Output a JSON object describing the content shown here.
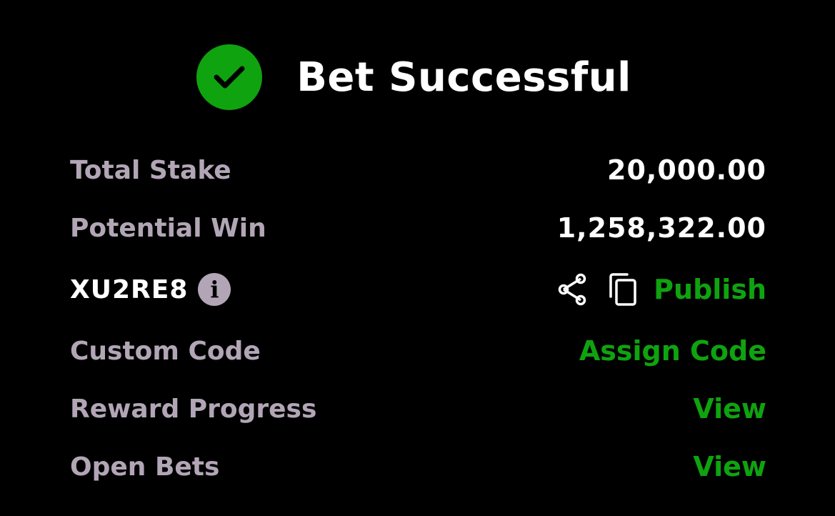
{
  "header": {
    "title": "Bet Successful",
    "icon": "check-circle-icon",
    "icon_color": "#0fa30f"
  },
  "summary": {
    "total_stake": {
      "label": "Total Stake",
      "value": "20,000.00"
    },
    "potential_win": {
      "label": "Potential Win",
      "value": "1,258,322.00"
    }
  },
  "booking": {
    "code": "XU2RE8",
    "info_icon": "info-icon",
    "share_icon": "share-icon",
    "copy_icon": "copy-icon",
    "publish_label": "Publish"
  },
  "custom_code": {
    "label": "Custom Code",
    "action": "Assign Code"
  },
  "reward_progress": {
    "label": "Reward Progress",
    "action": "View"
  },
  "open_bets": {
    "label": "Open Bets",
    "action": "View"
  },
  "colors": {
    "background": "#000000",
    "accent": "#0fa30f",
    "muted_text": "#b2a6b6",
    "primary_text": "#ffffff"
  }
}
